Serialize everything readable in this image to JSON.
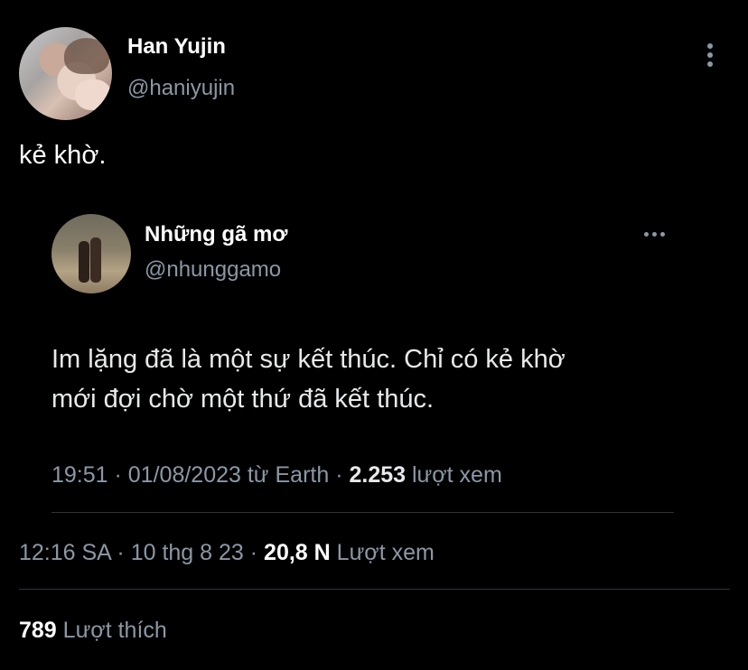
{
  "author": {
    "name": "Han Yujin",
    "handle": "@haniyujin"
  },
  "tweet": {
    "text": "kẻ khờ.",
    "time": "12:16 SA",
    "date": "10 thg 8 23",
    "views_count": "20,8 N",
    "views_label": "Lượt xem",
    "likes_count": "789",
    "likes_label": "Lượt thích"
  },
  "quoted": {
    "name": "Những gã mơ",
    "handle": "@nhunggamo",
    "text_line1": "Im lặng đã là một sự kết thúc. Chỉ có kẻ khờ",
    "text_line2": "mới đợi chờ một thứ đã kết thúc.",
    "time": "19:51",
    "date": "01/08/2023",
    "source": "từ Earth",
    "views_count": "2.253",
    "views_label": "lượt xem"
  },
  "icons": {
    "more_vertical": "more-vertical-icon",
    "more_horizontal": "more-horizontal-icon"
  },
  "colors": {
    "background": "#000000",
    "text_primary": "#e7e9ea",
    "text_secondary": "#8b98a5"
  }
}
